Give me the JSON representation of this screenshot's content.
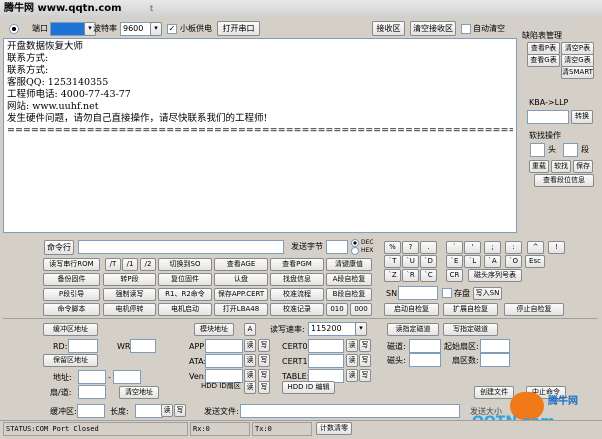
{
  "watermark": "腾牛网 www.qqtn.com",
  "title_suffix": "t",
  "top": {
    "port_label": "端口",
    "baud_label": "波特率",
    "baud_value": "9600",
    "checkbox_small": "小板供电",
    "open_port": "打开串口",
    "receive_area": "接收区",
    "clear_receive": "清空接收区",
    "auto_clear": "自动清空"
  },
  "console": {
    "lines": [
      "开盘数据恢复大师",
      "联系方式:",
      "联系方式:",
      "客服QQ: 1253140355",
      "工程师电话: 4000-77-43-77",
      "网站: www.uuhf.net",
      "发生硬件问题，请勿自己直接操作，请尽快联系我们的工程师!",
      "========================================================================"
    ]
  },
  "right": {
    "defect_title": "缺陷表管理",
    "btn_view_p": "查看P表",
    "btn_clear_p": "清空P表",
    "btn_view_g": "查看G表",
    "btn_clear_g": "清空G表",
    "btn_clear_smart": "清SMART",
    "kba_label": "KBA->LLP",
    "convert": "转换",
    "soft_label": "软找操作",
    "head_label": "头",
    "seg_label": "段",
    "reboot": "重载",
    "soft_find": "软找",
    "save": "保存",
    "view_seg": "查看段位信息"
  },
  "cmd": {
    "cmd_line": "命令行",
    "send_bytes": "发送字节",
    "dec": "DEC",
    "hex": "HEX",
    "sym_keys": [
      "%",
      "?",
      ".",
      "`",
      "'",
      ";",
      ":",
      "^",
      "!"
    ],
    "keys2": [
      "`T",
      "`U",
      "`D",
      "`E",
      "`L",
      "`A",
      "`O",
      "Esc"
    ],
    "keys3": [
      "`Z",
      "`R",
      "`C",
      "CR",
      "磁头序列号表"
    ],
    "sn_label": "SN:",
    "save_disk": "存盘",
    "write_sn": "写入SN"
  },
  "grid": [
    [
      "读写串行ROM",
      "/T",
      "/1",
      "/2",
      "切换到SO",
      "查看AGE",
      "查看PGM",
      "清键康值"
    ],
    [
      "备份固件",
      "转P段",
      "复位固件",
      "认盘",
      "找盘信息",
      "A段自检复"
    ],
    [
      "P段引导",
      "强制读写",
      "R1、R2命令",
      "保存APP.CERT",
      "校准流程",
      "B段自检复"
    ],
    [
      "命令脚本",
      "电机停转",
      "电机启动",
      "打开LBA48",
      "校准记录",
      "010",
      "000"
    ]
  ],
  "selfcheck": {
    "start": "启动自检复",
    "expand": "扩展自检复",
    "stop": "停止自检复"
  },
  "bottom": {
    "buffer_addr": "缓冲区地址",
    "rd": "RD:",
    "wr": "WR:",
    "save_area": "保留区地址",
    "addr": "地址:",
    "rng": "扇/道:",
    "clear_addr": "清空地址",
    "module_addr": "模块地址",
    "a": "A",
    "read_rate": "读写速率:",
    "rate_value": "115200",
    "app": "APP:",
    "ata": "ATA:",
    "ven": "Ven:",
    "cert0": "CERT0:",
    "cert1": "CERT1:",
    "table": "TABLE:",
    "read": "读",
    "write": "写",
    "hdd_id_area": "HDD ID扇区",
    "hdd_id_edit": "HDD ID 编辑",
    "read_fixed": "读指定磁道",
    "write_fixed": "写指定磁道",
    "track": "磁道:",
    "start_sector": "起始扇区:",
    "head": "磁头:",
    "sector_count": "扇区数:",
    "buffer_area": "缓冲区:",
    "length": "长度:",
    "send_file": "发送文件:",
    "create_file": "创建文件",
    "stop_cmd": "中止命令",
    "send_size": "发送大小"
  },
  "status": {
    "port": "STATUS:COM Port Closed",
    "rx": "Rx:0",
    "tx": "Tx:0",
    "count_clear": "计数清零"
  },
  "logo": {
    "brand": "腾牛网",
    "site": "QQTN.com"
  }
}
